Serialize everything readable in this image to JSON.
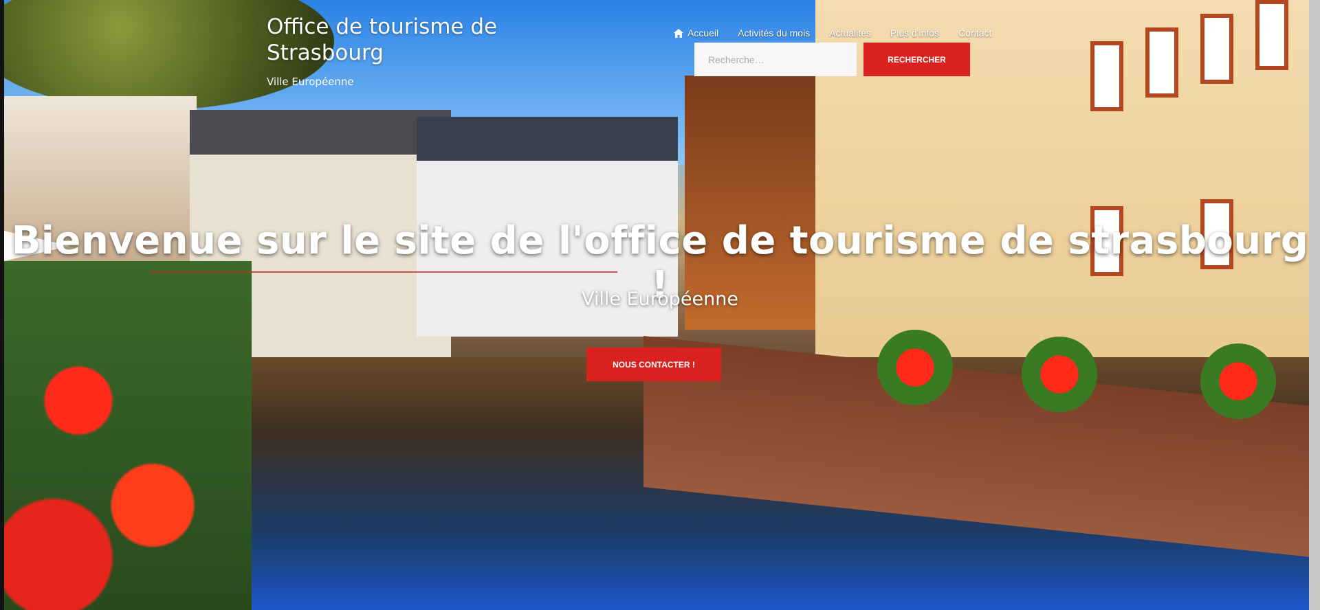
{
  "brand": {
    "title": "Office de tourisme de Strasbourg",
    "tagline": "Ville Européenne"
  },
  "nav": {
    "items": [
      {
        "label": "Accueil",
        "icon": "home-icon"
      },
      {
        "label": "Activités du mois"
      },
      {
        "label": "Actualités"
      },
      {
        "label": "Plus d'infos"
      },
      {
        "label": "Contact"
      }
    ]
  },
  "search": {
    "placeholder": "Recherche…",
    "button_label": "RECHERCHER"
  },
  "hero": {
    "headline": "Bienvenue sur le site de l'office de tourisme de strasbourg !",
    "subheadline": "Ville Européenne",
    "cta_label": "NOUS CONTACTER !"
  },
  "colors": {
    "accent": "#d9211f",
    "text": "#ffffff"
  }
}
